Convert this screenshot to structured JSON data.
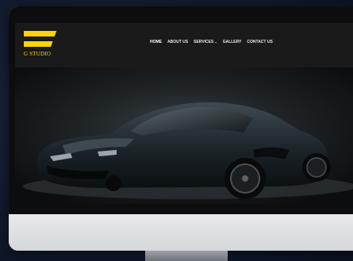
{
  "brand": {
    "logo_text": "G STUDIO",
    "accent_color": "#ffd400"
  },
  "nav": {
    "items": [
      {
        "label": "HOME"
      },
      {
        "label": "ABOUT US"
      },
      {
        "label": "SERVICES"
      },
      {
        "label": "GALLERY"
      },
      {
        "label": "CONTACT US"
      }
    ],
    "services_caret": "⌄"
  },
  "hero": {
    "image": "sports-car-photo",
    "car_color": "#1e262c"
  },
  "icons": {
    "dropdown": "chevron-down-icon"
  }
}
